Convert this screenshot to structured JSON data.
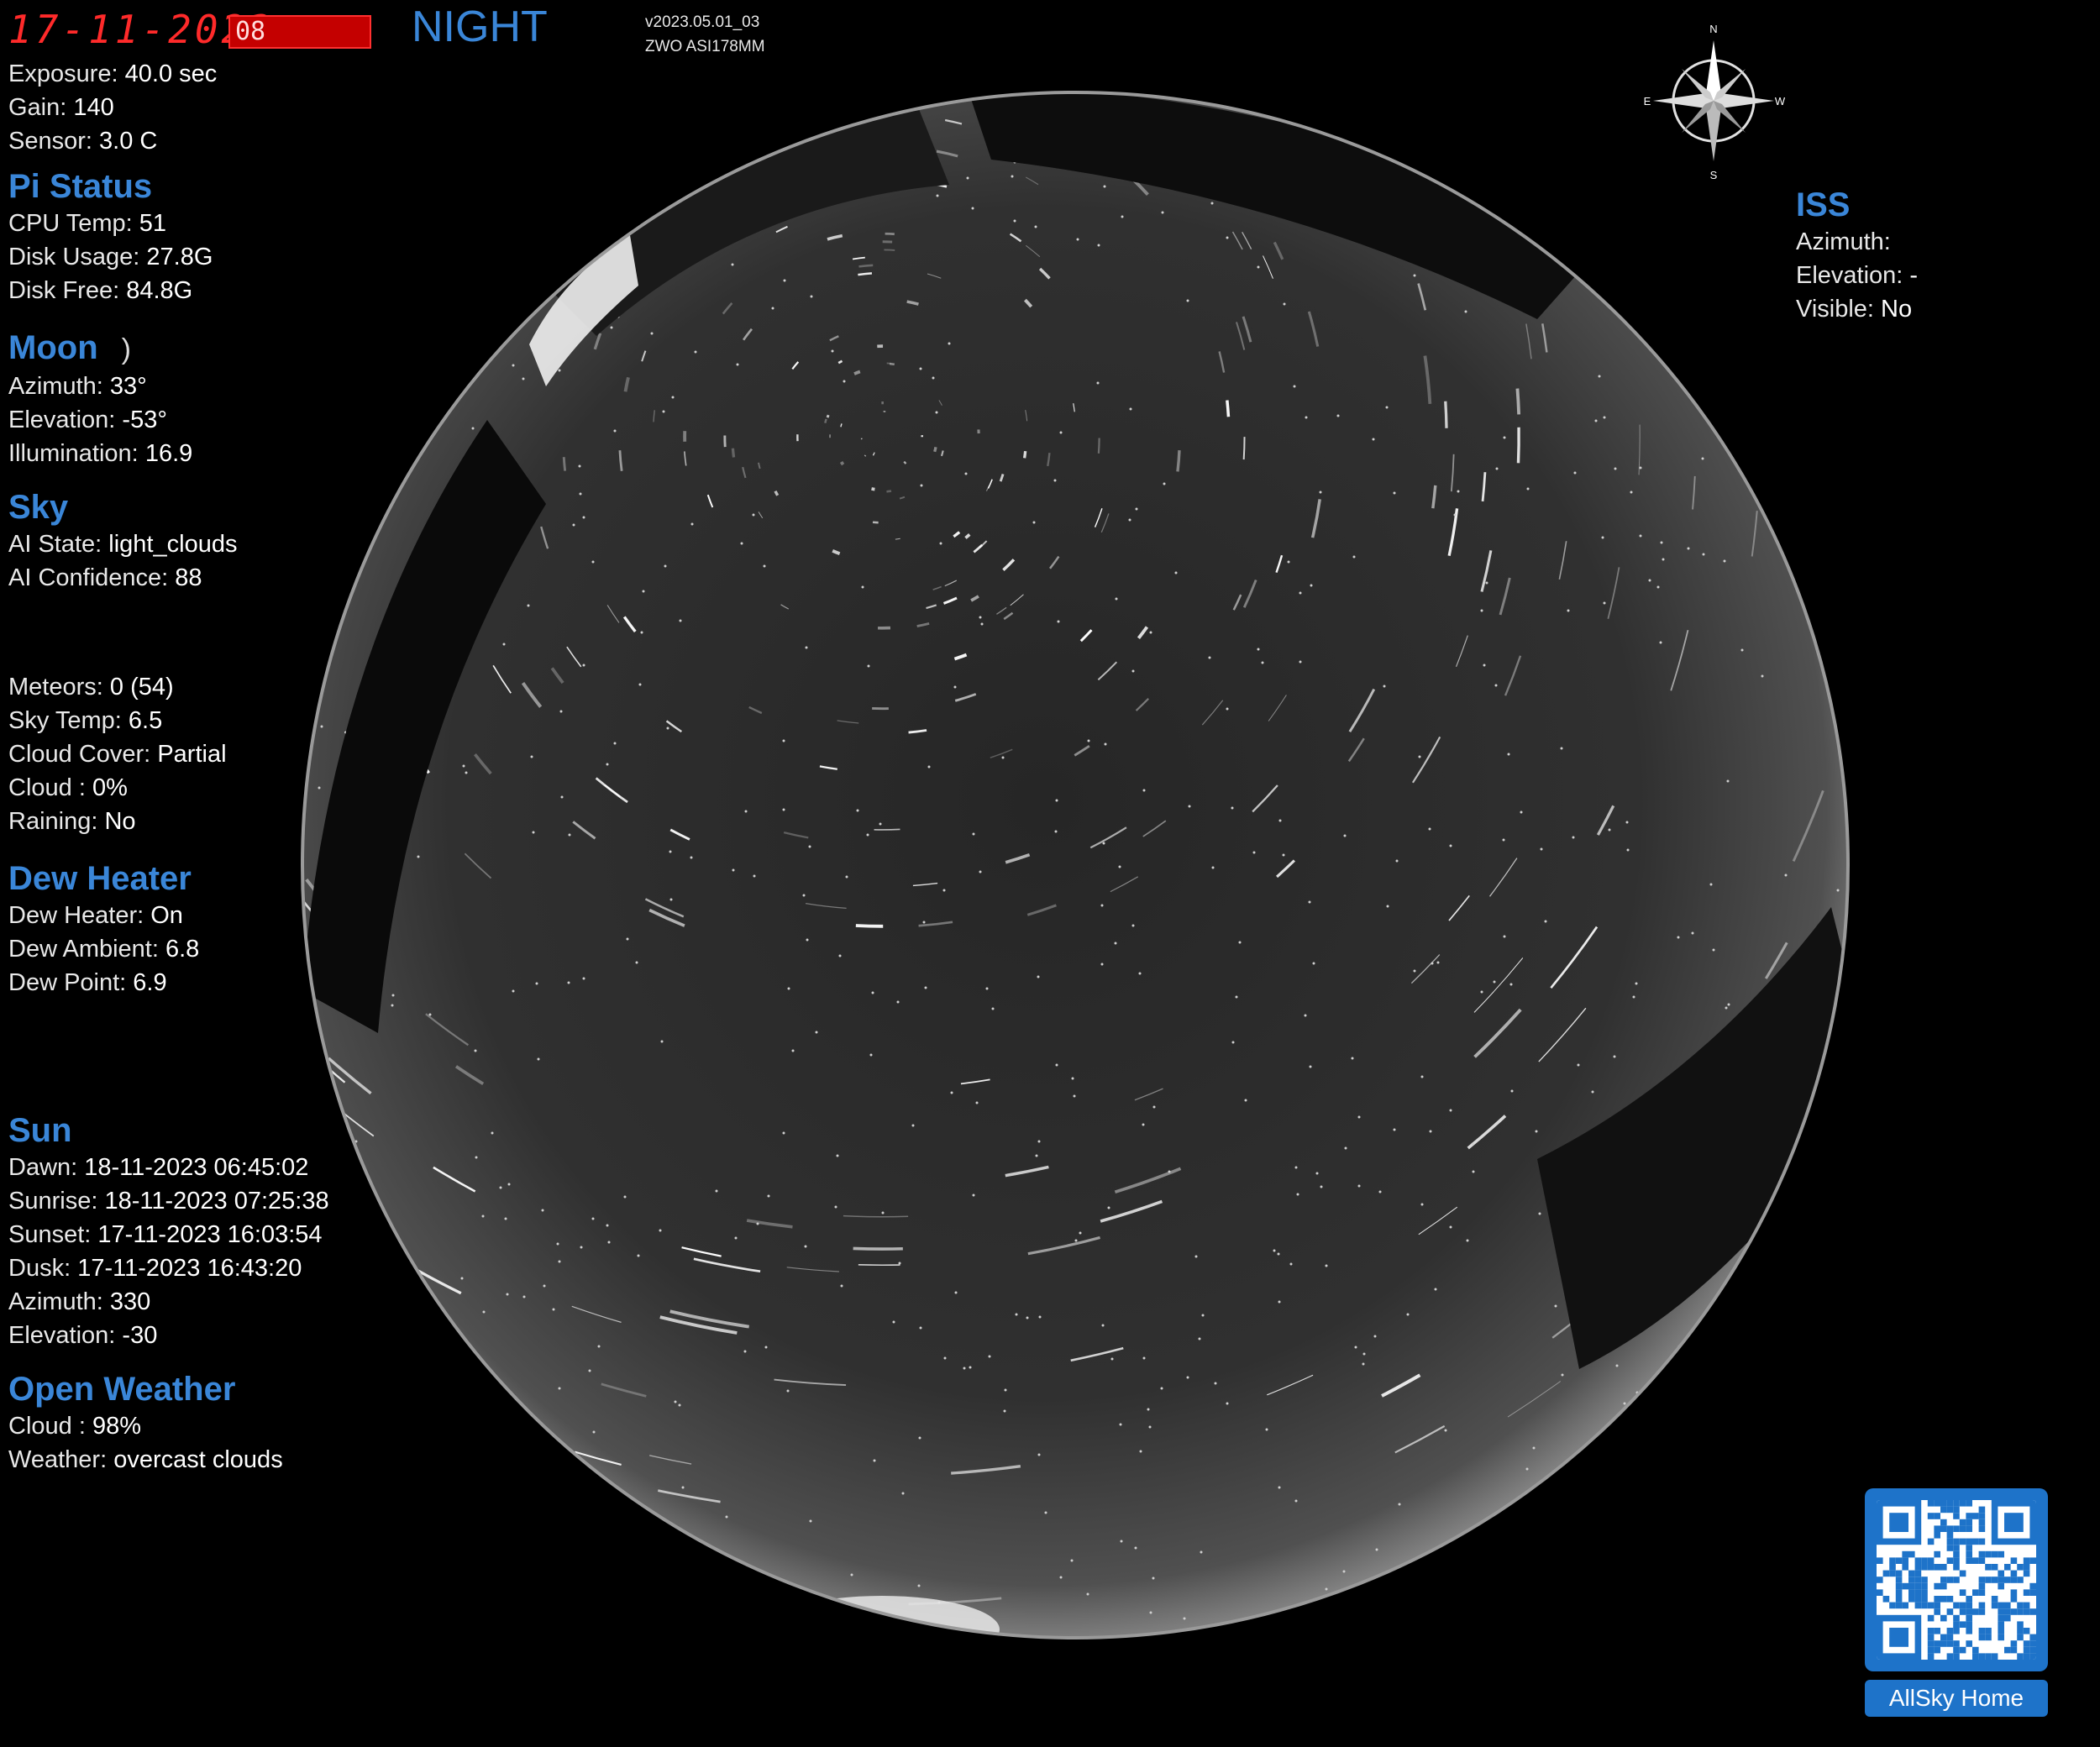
{
  "header": {
    "date": "17-11-2023",
    "time": "08",
    "mode": "NIGHT",
    "version": "v2023.05.01_03",
    "camera": "ZWO ASI178MM"
  },
  "camera": {
    "exposure_label": "Exposure:",
    "exposure_value": "40.0 sec",
    "gain_label": "Gain:",
    "gain_value": "140",
    "sensor_label": "Sensor:",
    "sensor_value": "3.0 C"
  },
  "pi_status": {
    "title": "Pi Status",
    "cpu_label": "CPU Temp:",
    "cpu_value": "51",
    "disk_usage_label": "Disk Usage:",
    "disk_usage_value": "27.8G",
    "disk_free_label": "Disk Free:",
    "disk_free_value": "84.8G"
  },
  "moon": {
    "title": "Moon",
    "phase_glyph": ")",
    "azimuth_label": "Azimuth:",
    "azimuth_value": "33°",
    "elevation_label": "Elevation:",
    "elevation_value": "-53°",
    "illumination_label": "Illumination:",
    "illumination_value": "16.9"
  },
  "sky": {
    "title": "Sky",
    "ai_state_label": "AI State:",
    "ai_state_value": "light_clouds",
    "ai_conf_label": "AI Confidence:",
    "ai_conf_value": "88"
  },
  "conditions": {
    "meteors_label": "Meteors:",
    "meteors_value": "0 (54)",
    "sky_temp_label": "Sky Temp:",
    "sky_temp_value": "6.5",
    "cloud_cover_label": "Cloud Cover:",
    "cloud_cover_value": "Partial",
    "cloud_label": "Cloud :",
    "cloud_value": "0%",
    "raining_label": "Raining:",
    "raining_value": "No"
  },
  "dew_heater": {
    "title": "Dew Heater",
    "heater_label": "Dew Heater:",
    "heater_value": "On",
    "ambient_label": "Dew Ambient:",
    "ambient_value": "6.8",
    "point_label": "Dew Point:",
    "point_value": "6.9"
  },
  "sun": {
    "title": "Sun",
    "dawn_label": "Dawn:",
    "dawn_value": "18-11-2023 06:45:02",
    "sunrise_label": "Sunrise:",
    "sunrise_value": "18-11-2023 07:25:38",
    "sunset_label": "Sunset:",
    "sunset_value": "17-11-2023 16:03:54",
    "dusk_label": "Dusk:",
    "dusk_value": "17-11-2023 16:43:20",
    "azimuth_label": "Azimuth:",
    "azimuth_value": "330",
    "elevation_label": "Elevation:",
    "elevation_value": "-30"
  },
  "open_weather": {
    "title": "Open Weather",
    "cloud_label": "Cloud :",
    "cloud_value": "98%",
    "weather_label": "Weather:",
    "weather_value": "overcast clouds"
  },
  "iss": {
    "title": "ISS",
    "azimuth_label": "Azimuth:",
    "azimuth_value": "",
    "elevation_label": "Elevation:",
    "elevation_value": "-",
    "visible_label": "Visible:",
    "visible_value": "No"
  },
  "compass": {
    "n": "N",
    "s": "S",
    "e": "E",
    "w": "W"
  },
  "qr": {
    "label": "AllSky Home"
  },
  "colors": {
    "accent": "#3a86d8",
    "date_red": "#ff2a2a",
    "qr_blue": "#1e73c9"
  }
}
